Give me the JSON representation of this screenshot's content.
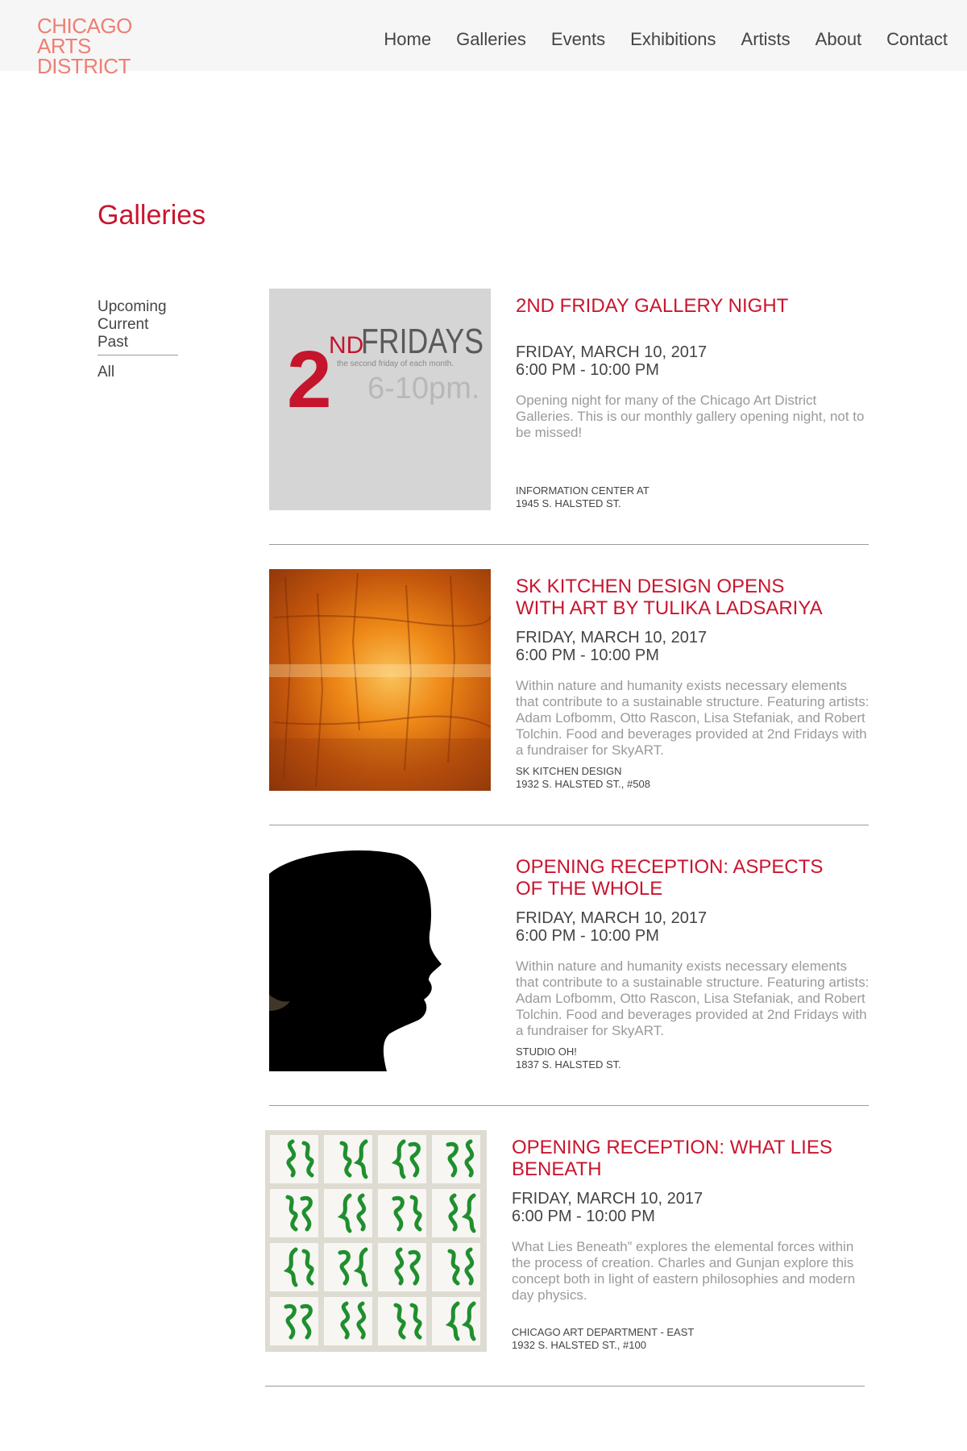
{
  "header": {
    "logo_lines": [
      "CHICAGO",
      "ARTS",
      "DISTRICT"
    ],
    "nav": [
      "Home",
      "Galleries",
      "Events",
      "Exhibitions",
      "Artists",
      "About",
      "Contact"
    ]
  },
  "page_title": "Galleries",
  "filters": {
    "primary": [
      "Upcoming",
      "Current",
      "Past"
    ],
    "all": "All"
  },
  "events": [
    {
      "title": "2ND FRIDAY GALLERY NIGHT",
      "date": "FRIDAY, MARCH 10, 2017",
      "time": "6:00 PM - 10:00 PM",
      "description": "Opening night for many of the Chicago Art District Galleries. This is our monthly gallery opening night, not to be missed!",
      "location_name": "INFORMATION CENTER AT",
      "location_address": "1945 S. HALSTED ST.",
      "image": {
        "kind": "2nd-fridays-poster",
        "big_number": "2",
        "superscript": "ND",
        "word": "FRIDAYS",
        "tagline": "the second friday of each month.",
        "hours": "6-10pm."
      }
    },
    {
      "title": "SK KITCHEN DESIGN OPENS WITH ART BY TULIKA LADSARIYA",
      "date": "FRIDAY, MARCH 10, 2017",
      "time": "6:00 PM - 10:00 PM",
      "description": "Within nature and humanity exists necessary elements that contribute to a sustainable structure. Featuring artists: Adam Lofbomm, Otto Rascon, Lisa Stefaniak, and Robert Tolchin. Food and beverages provided at 2nd Fridays with a fundraiser for SkyART.",
      "location_name": "SK KITCHEN DESIGN",
      "location_address": "1932 S. HALSTED ST., #508",
      "image": {
        "kind": "orange-abstract-painting"
      }
    },
    {
      "title": "OPENING RECEPTION: ASPECTS OF THE WHOLE",
      "date": "FRIDAY, MARCH 10, 2017",
      "time": "6:00 PM - 10:00 PM",
      "description": "Within nature and humanity exists necessary elements that contribute to a sustainable structure. Featuring artists: Adam Lofbomm, Otto Rascon, Lisa Stefaniak, and Robert Tolchin. Food and beverages provided at 2nd Fridays with a fundraiser for SkyART.",
      "location_name": "STUDIO OH!",
      "location_address": "1837 S. HALSTED ST.",
      "image": {
        "kind": "profile-silhouette"
      }
    },
    {
      "title": "OPENING RECEPTION: WHAT LIES BENEATH",
      "date": "FRIDAY, MARCH 10, 2017",
      "time": "6:00 PM - 10:00 PM",
      "description": "What Lies Beneath” explores the elemental forces within the process of creation. Charles and Gunjan explore this concept both in light of eastern philosophies and modern day physics.",
      "location_name": "CHICAGO ART DEPARTMENT - EAST",
      "location_address": "1932 S. HALSTED ST., #100",
      "image": {
        "kind": "green-glyph-tiles"
      }
    }
  ],
  "colors": {
    "accent_red": "#c9152f",
    "logo_salmon": "#ee7f74",
    "header_bg": "#f6f6f6",
    "muted_text": "#9a9a9a",
    "glyph_green": "#1f8f2e"
  }
}
